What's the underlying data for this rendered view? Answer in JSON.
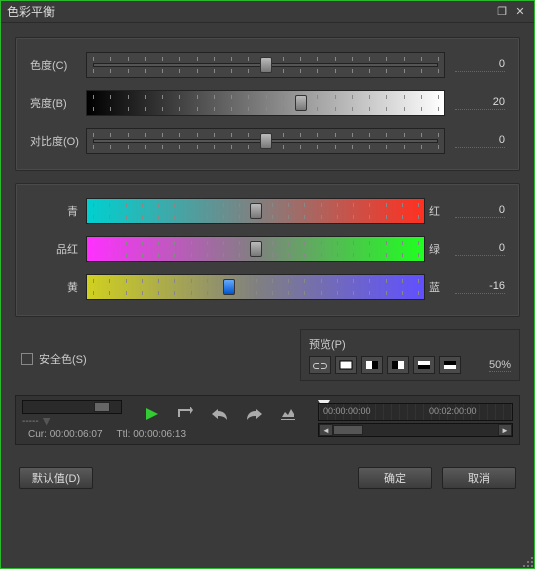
{
  "title": "色彩平衡",
  "sliders1": [
    {
      "label": "色度(C)",
      "value": "0",
      "pos": 50,
      "bg": ""
    },
    {
      "label": "亮度(B)",
      "value": "20",
      "pos": 60,
      "bg": "brightness-bg"
    },
    {
      "label": "对比度(O)",
      "value": "0",
      "pos": 50,
      "bg": ""
    }
  ],
  "sliders2": [
    {
      "labelL": "青",
      "labelR": "红",
      "value": "0",
      "pos": 50,
      "bg": "grad-cr",
      "thumb": ""
    },
    {
      "labelL": "品红",
      "labelR": "绿",
      "value": "0",
      "pos": 50,
      "bg": "grad-mg",
      "thumb": ""
    },
    {
      "labelL": "黄",
      "labelR": "蓝",
      "value": "-16",
      "pos": 42,
      "bg": "grad-yb",
      "thumb": "blue"
    }
  ],
  "safe_label": "安全色(S)",
  "preview": {
    "title": "预览(P)",
    "value": "50%"
  },
  "timeline": {
    "t1": "00:00:00:00",
    "t2": "00:02:00:00"
  },
  "timecode": {
    "cur_label": "Cur:",
    "cur": "00:00:06:07",
    "ttl_label": "Ttl:",
    "ttl": "00:00:06:13"
  },
  "buttons": {
    "default": "默认值(D)",
    "ok": "确定",
    "cancel": "取消"
  }
}
